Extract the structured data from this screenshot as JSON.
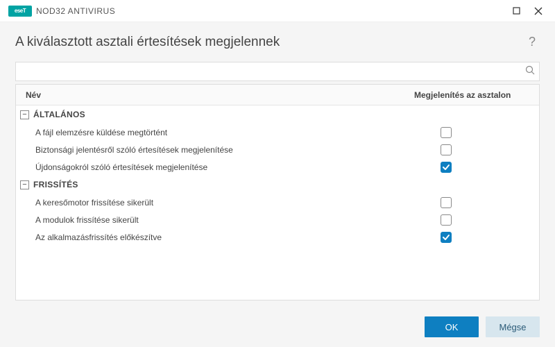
{
  "brand": {
    "logo_text": "eseT",
    "product": "NOD32 ANTIVIRUS"
  },
  "heading": "A kiválasztott asztali értesítések megjelennek",
  "search": {
    "value": "",
    "placeholder": ""
  },
  "columns": {
    "name": "Név",
    "show": "Megjelenítés az asztalon"
  },
  "groups": [
    {
      "label": "ÁLTALÁNOS",
      "expanded": true,
      "items": [
        {
          "label": "A fájl elemzésre küldése megtörtént",
          "checked": false
        },
        {
          "label": "Biztonsági jelentésről szóló értesítések megjelenítése",
          "checked": false
        },
        {
          "label": "Újdonságokról szóló értesítések megjelenítése",
          "checked": true
        }
      ]
    },
    {
      "label": "FRISSÍTÉS",
      "expanded": true,
      "items": [
        {
          "label": "A keresőmotor frissítése sikerült",
          "checked": false
        },
        {
          "label": "A modulok frissítése sikerült",
          "checked": false
        },
        {
          "label": "Az alkalmazásfrissítés előkészítve",
          "checked": true
        }
      ]
    }
  ],
  "buttons": {
    "ok": "OK",
    "cancel": "Mégse"
  }
}
